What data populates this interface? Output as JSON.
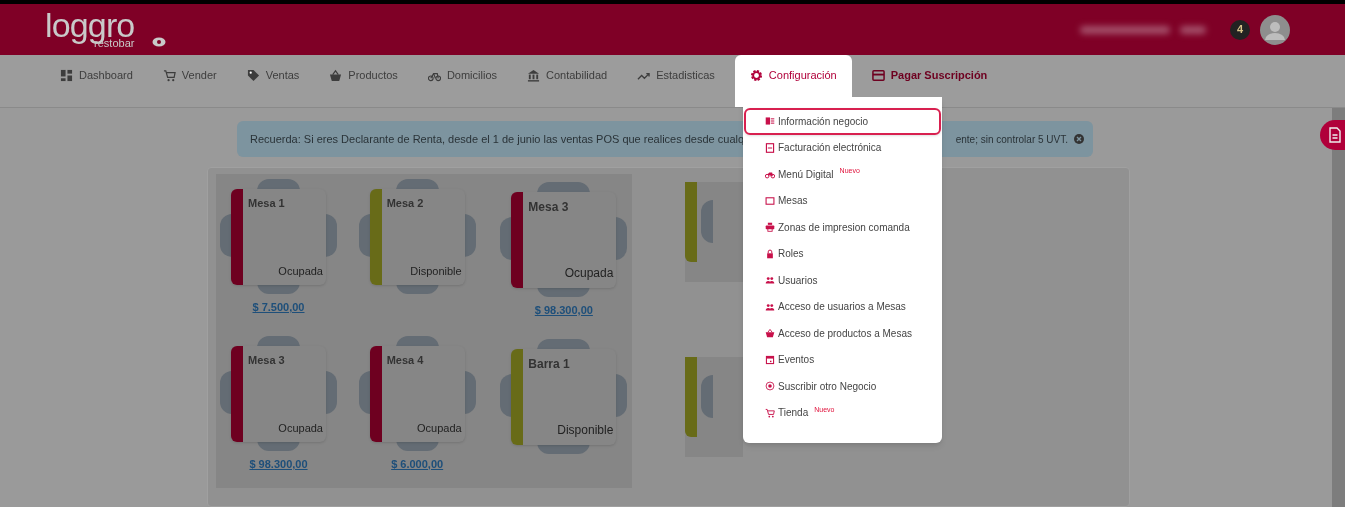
{
  "header": {
    "logo": "loggro",
    "logo_sub": "restobar",
    "notifications": "4"
  },
  "nav": [
    {
      "label": "Dashboard",
      "selected": false
    },
    {
      "label": "Vender",
      "selected": false
    },
    {
      "label": "Ventas",
      "selected": false
    },
    {
      "label": "Productos",
      "selected": false
    },
    {
      "label": "Domicilios",
      "selected": false
    },
    {
      "label": "Contabilidad",
      "selected": false
    },
    {
      "label": "Estadisticas",
      "selected": false
    },
    {
      "label": "Configuración",
      "selected": true
    },
    {
      "label": "Pagar Suscripción",
      "selected": false
    }
  ],
  "alert": {
    "text_start": "Recuerda: Si eres Declarante de Renta, desde el 1 de junio las ventas POS que realices desde cualq",
    "text_end": "ente; sin controlar 5 UVT."
  },
  "tables": [
    {
      "name": "Mesa 1",
      "status": "Ocupada",
      "color": "#6e0020",
      "amount": "$ 7.500,00"
    },
    {
      "name": "Mesa 2",
      "status": "Disponible",
      "color": "#686b18"
    },
    {
      "name": "Mesa 3",
      "status": "Ocupada",
      "color": "#6e0020",
      "amount": "$ 98.300,00"
    },
    {
      "name": "Mesa 3",
      "status": "Ocupada",
      "color": "#6e0020",
      "amount": "$ 98.300,00"
    },
    {
      "name": "Mesa 4",
      "status": "Ocupada",
      "color": "#6e0020",
      "amount": "$ 6.000,00"
    },
    {
      "name": "Barra 1",
      "status": "Disponible",
      "color": "#686b18"
    }
  ],
  "partial_tables": [
    {
      "color": "#686b18"
    },
    {
      "color": "#686b18"
    }
  ],
  "menu": [
    {
      "label": "Información negocio",
      "selected": true
    },
    {
      "label": "Facturación electrónica",
      "selected": false
    },
    {
      "label": "Menú Digital",
      "badge": "Nuevo",
      "selected": false
    },
    {
      "label": "Mesas",
      "selected": false
    },
    {
      "label": "Zonas de impresion comanda",
      "selected": false
    },
    {
      "label": "Roles",
      "selected": false
    },
    {
      "label": "Usuarios",
      "selected": false
    },
    {
      "label": "Acceso de usuarios a Mesas",
      "selected": false
    },
    {
      "label": "Acceso de productos a Mesas",
      "selected": false
    },
    {
      "label": "Eventos",
      "selected": false
    },
    {
      "label": "Suscribir otro Negocio",
      "selected": false
    },
    {
      "label": "Tienda",
      "badge": "Nuevo",
      "selected": false
    }
  ]
}
